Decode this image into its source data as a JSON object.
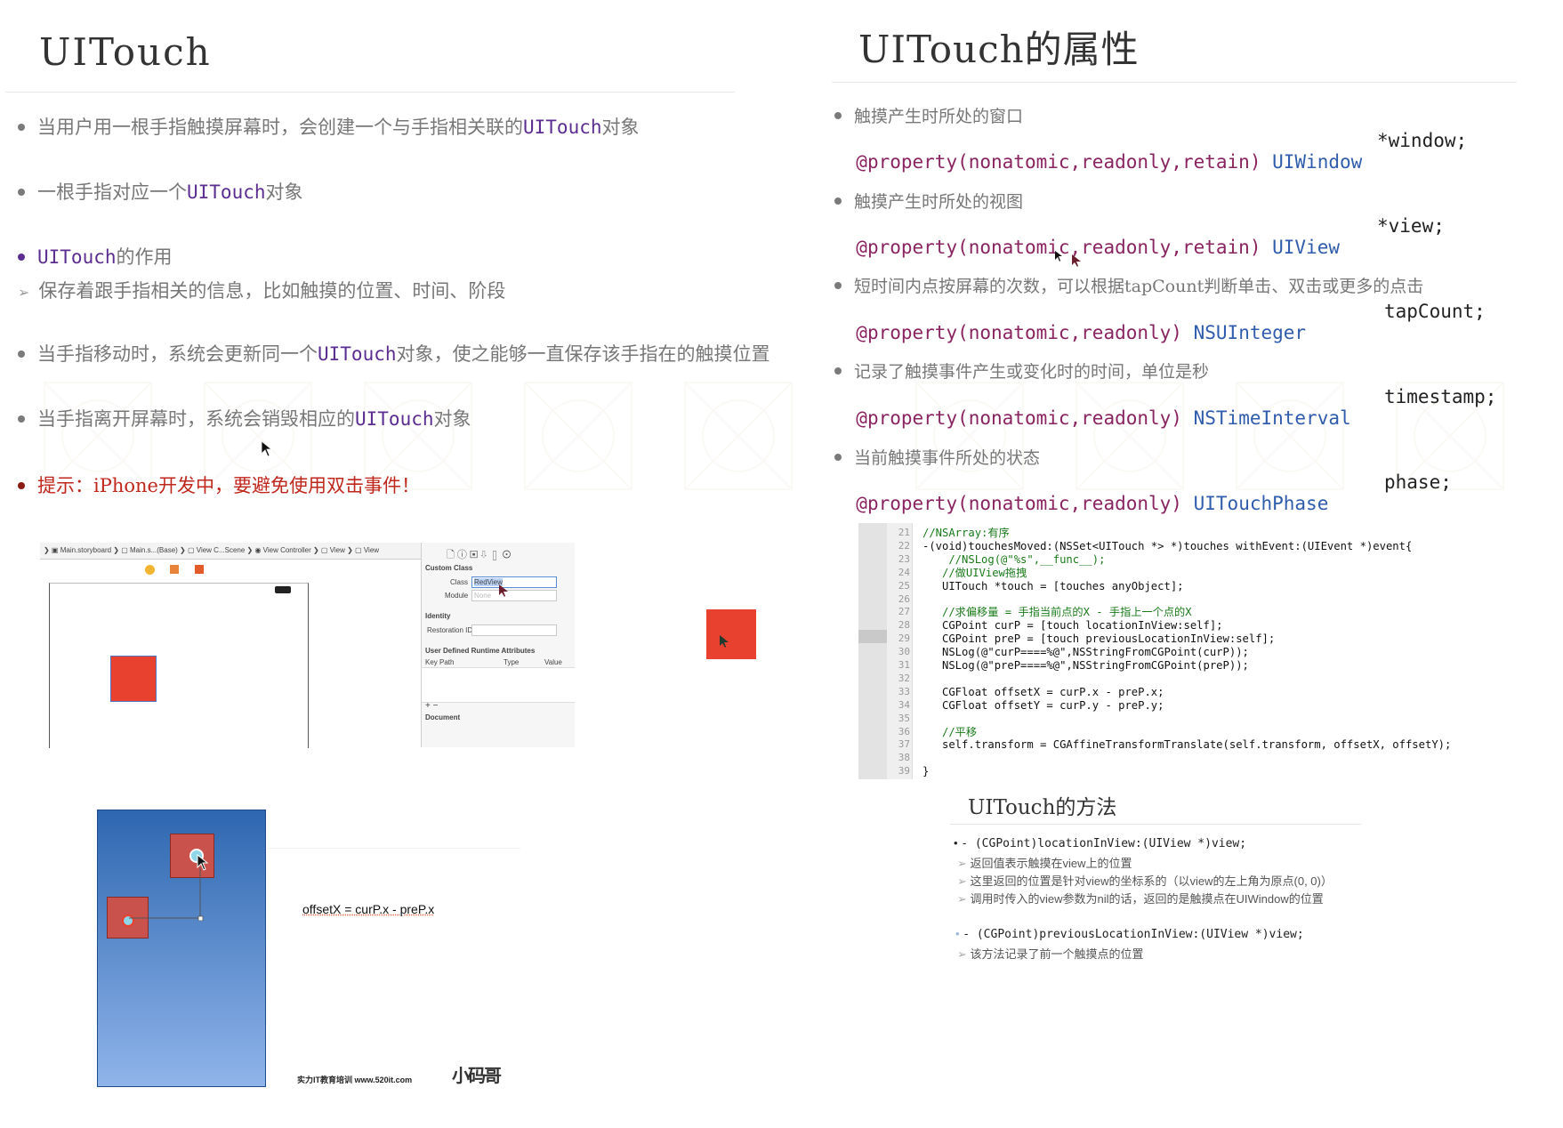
{
  "left": {
    "title": "UITouch",
    "bullets": [
      {
        "pre": "当用户用一根手指触摸屏幕时，会创建一个与手指相关联的",
        "hl": "UITouch",
        "post": "对象"
      },
      {
        "pre": "一根手指对应一个",
        "hl": "UITouch",
        "post": "对象"
      },
      {
        "pre": "",
        "hl": "UITouch",
        "post": "的作用"
      },
      {
        "pre": "保存着跟手指相关的信息，比如触摸的位置、时间、阶段",
        "hl": "",
        "post": ""
      },
      {
        "pre": "当手指移动时，系统会更新同一个",
        "hl": "UITouch",
        "post": "对象，使之能够一直保存该手指在的触摸位置"
      },
      {
        "pre": "当手指离开屏幕时，系统会销毁相应的",
        "hl": "UITouch",
        "post": "对象"
      },
      {
        "pre": "提示：iPhone开发中，要避免使用双击事件！",
        "hl": "",
        "post": ""
      }
    ]
  },
  "right": {
    "title": "UITouch的属性",
    "props": [
      {
        "desc": "触摸产生时所处的窗口",
        "kw": "@property",
        "attrs": "(nonatomic,readonly,retain)",
        "type": "UIWindow",
        "name": "*window;"
      },
      {
        "desc": "触摸产生时所处的视图",
        "kw": "@property",
        "attrs": "(nonatomic,readonly,retain)",
        "type": "UIView",
        "name": "*view;"
      },
      {
        "desc": "短时间内点按屏幕的次数，可以根据tapCount判断单击、双击或更多的点击",
        "kw": "@property",
        "attrs": "(nonatomic,readonly)",
        "type": "NSUInteger",
        "name": "tapCount;"
      },
      {
        "desc": "记录了触摸事件产生或变化时的时间，单位是秒",
        "kw": "@property",
        "attrs": "(nonatomic,readonly)",
        "type": "NSTimeInterval",
        "name": "timestamp;"
      },
      {
        "desc": "当前触摸事件所处的状态",
        "kw": "@property",
        "attrs": "(nonatomic,readonly)",
        "type": "UITouchPhase",
        "name": "phase;"
      }
    ]
  },
  "ib": {
    "breadcrumb": [
      "Main.storyboard",
      "Main.s...(Base)",
      "View C...Scene",
      "View Controller",
      "View",
      "View"
    ],
    "custom_class": "Custom Class",
    "class_label": "Class",
    "class_value": "RedView",
    "module_label": "Module",
    "module_value": "None",
    "identity": "Identity",
    "restoration": "Restoration ID",
    "udra": "User Defined Runtime Attributes",
    "col_key": "Key Path",
    "col_type": "Type",
    "col_value": "Value",
    "document": "Document",
    "plusminus": "+  −"
  },
  "code": {
    "lines": [
      {
        "n": "21",
        "t": "//NSArray:有序",
        "c": "cm"
      },
      {
        "n": "22",
        "t": "-(void)touchesMoved:(NSSet<UITouch *> *)touches withEvent:(UIEvent *)event{",
        "c": ""
      },
      {
        "n": "23",
        "t": "    //NSLog(@\"%s\",__func__);",
        "c": "cm"
      },
      {
        "n": "24",
        "t": "   //做UIView拖拽",
        "c": "cm"
      },
      {
        "n": "25",
        "t": "   UITouch *touch = [touches anyObject];",
        "c": ""
      },
      {
        "n": "26",
        "t": "",
        "c": ""
      },
      {
        "n": "27",
        "t": "   //求偏移量 = 手指当前点的X - 手指上一个点的X",
        "c": "cm"
      },
      {
        "n": "28",
        "t": "   CGPoint curP = [touch locationInView:self];",
        "c": ""
      },
      {
        "n": "29",
        "t": "   CGPoint preP = [touch previousLocationInView:self];",
        "c": ""
      },
      {
        "n": "30",
        "t": "   NSLog(@\"curP====%@\",NSStringFromCGPoint(curP));",
        "c": ""
      },
      {
        "n": "31",
        "t": "   NSLog(@\"preP====%@\",NSStringFromCGPoint(preP));",
        "c": ""
      },
      {
        "n": "32",
        "t": "",
        "c": ""
      },
      {
        "n": "33",
        "t": "   CGFloat offsetX = curP.x - preP.x;",
        "c": ""
      },
      {
        "n": "34",
        "t": "   CGFloat offsetY = curP.y - preP.y;",
        "c": ""
      },
      {
        "n": "35",
        "t": "",
        "c": ""
      },
      {
        "n": "36",
        "t": "   //平移",
        "c": "cm"
      },
      {
        "n": "37",
        "t": "   self.transform = CGAffineTransformTranslate(self.transform, offsetX, offsetY);",
        "c": ""
      },
      {
        "n": "38",
        "t": "",
        "c": ""
      },
      {
        "n": "39",
        "t": "}",
        "c": ""
      }
    ]
  },
  "methods": {
    "title": "UITouch的方法",
    "m1": "- (CGPoint)locationInView:(UIView *)view;",
    "m1_notes": [
      "返回值表示触摸在view上的位置",
      "这里返回的位置是针对view的坐标系的（以view的左上角为原点(0, 0)）",
      "调用时传入的view参数为nil的话，返回的是触摸点在UIWindow的位置"
    ],
    "m2": "- (CGPoint)previousLocationInView:(UIView *)view;",
    "m2_notes": [
      "该方法记录了前一个触摸点的位置"
    ]
  },
  "diagram": {
    "formula": "offsetX = curP.x - preP.x",
    "footer": "实力IT教育培训 www.520it.com",
    "logo": "小码哥"
  },
  "colors": {
    "accent_purple": "#5c2d91",
    "hint_red": "#c0271c",
    "red_view": "#e8412f",
    "phone_top": "#2e67b0",
    "phone_bottom": "#8fb4ea"
  }
}
